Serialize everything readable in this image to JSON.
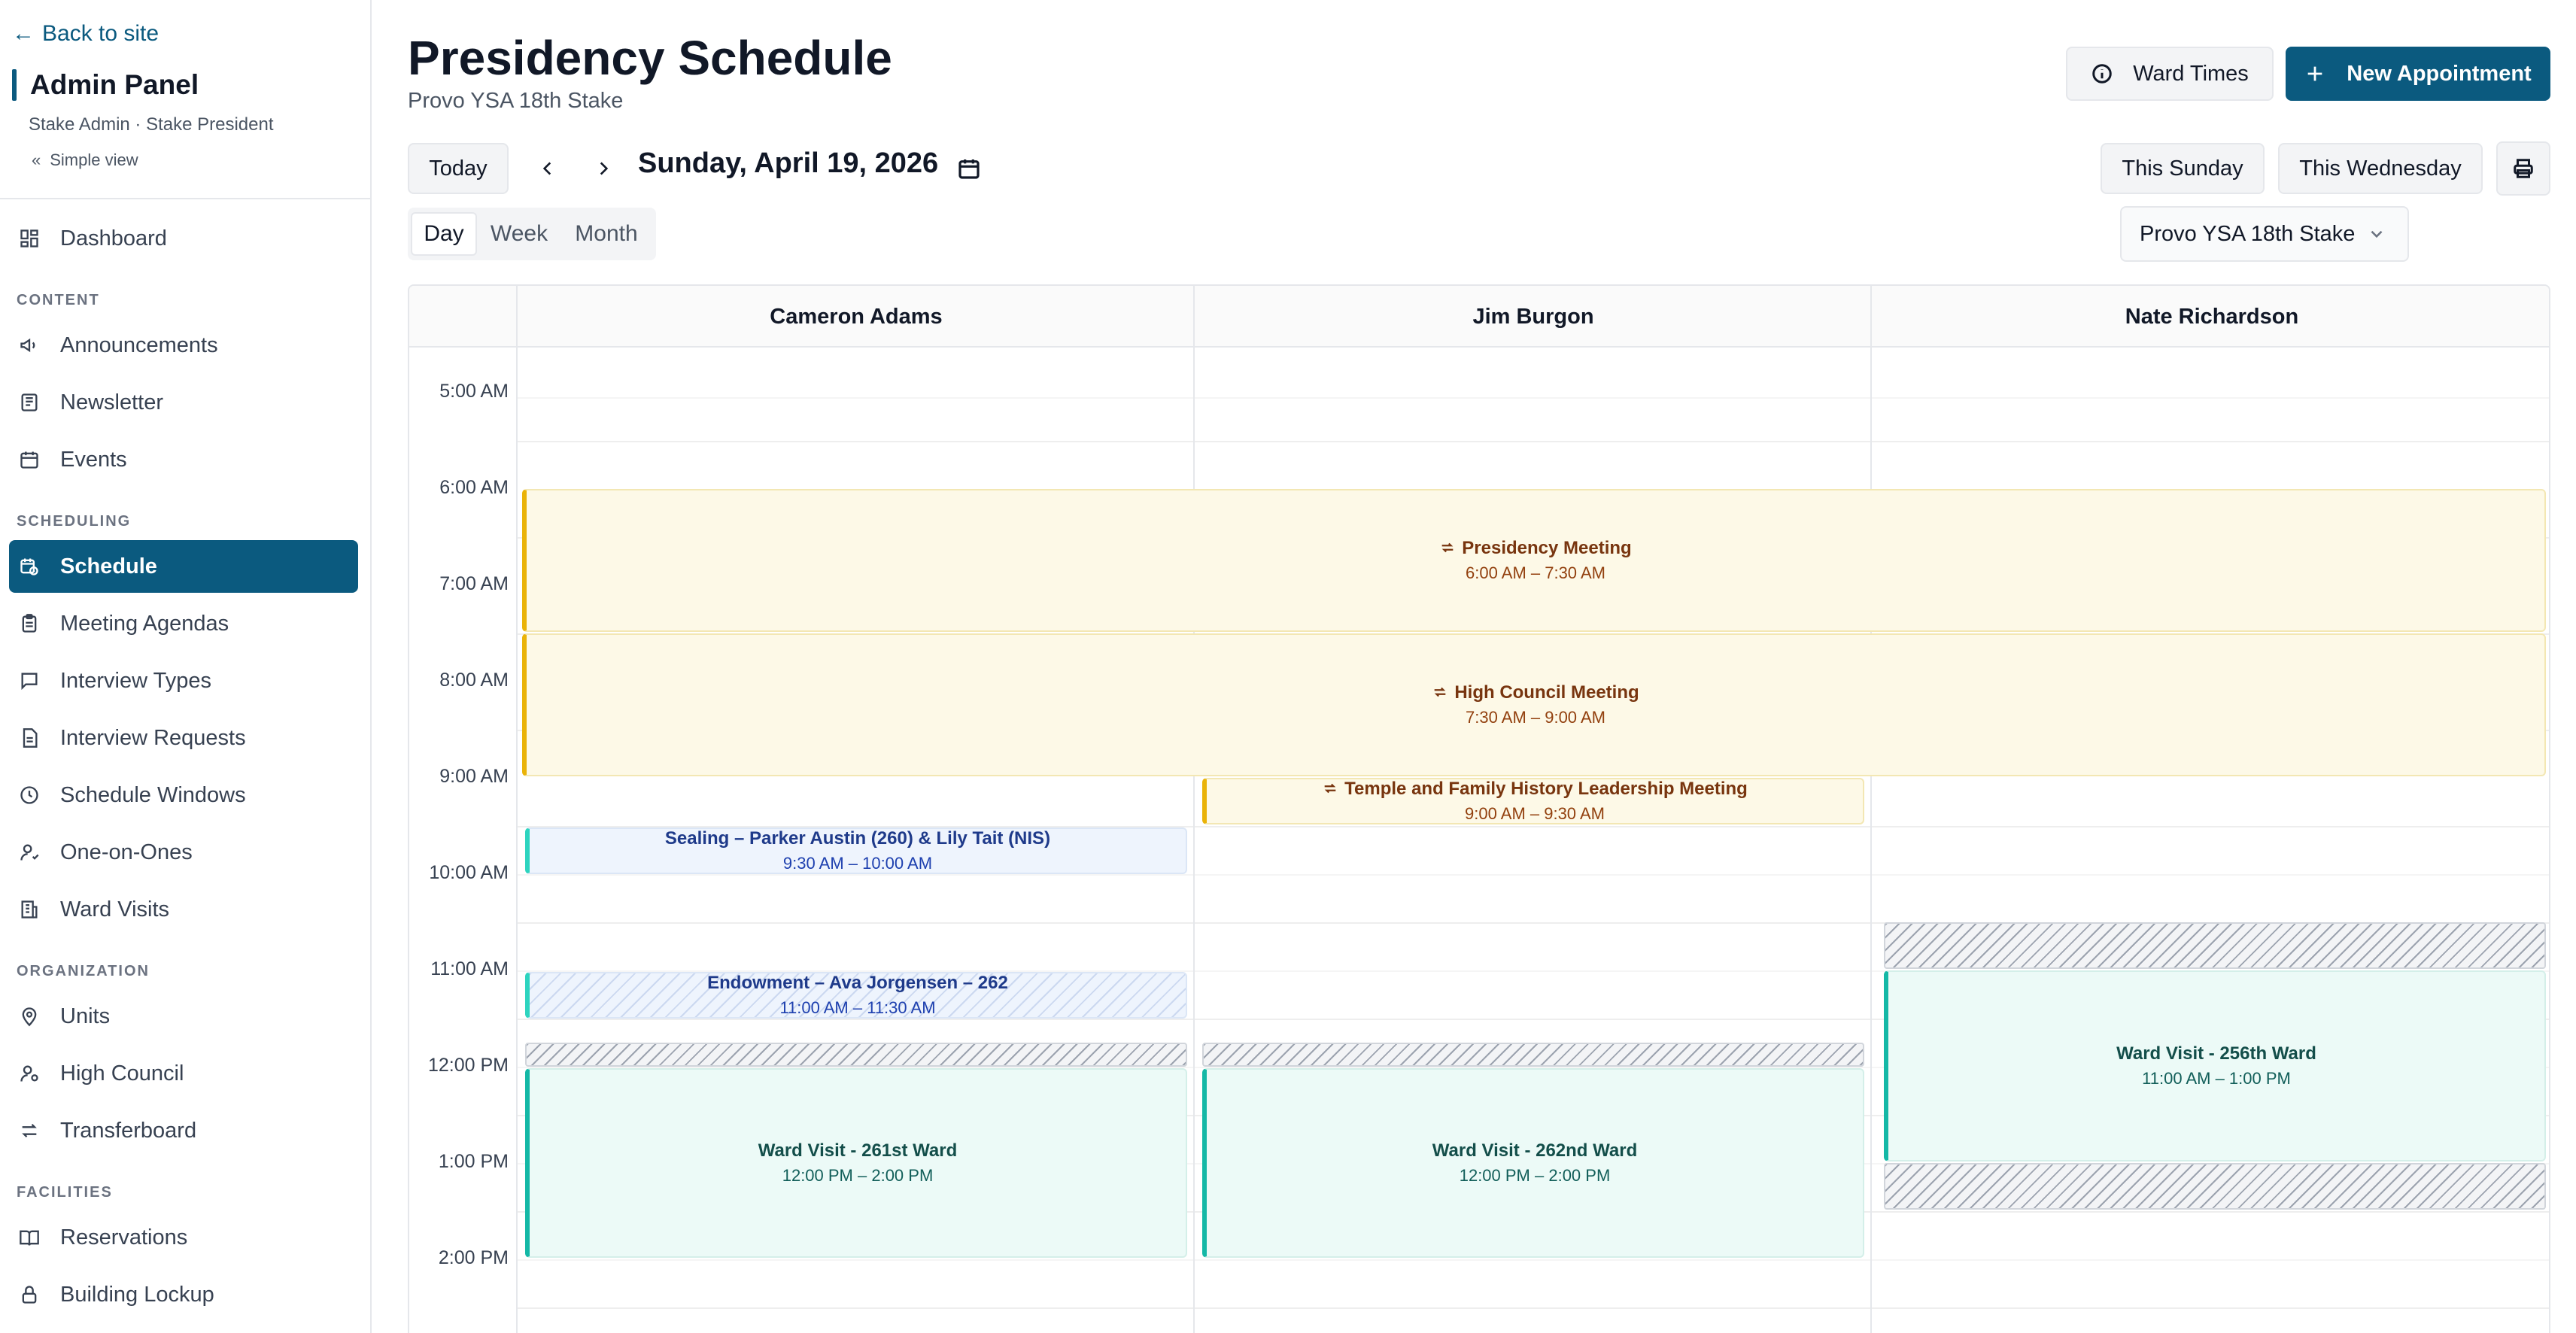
{
  "sidebar": {
    "back_label": "Back to site",
    "panel_title": "Admin Panel",
    "panel_subtitle": "Stake Admin · Stake President",
    "simple_view_label": "Simple view",
    "dashboard": "Dashboard",
    "sections": {
      "content": "CONTENT",
      "scheduling": "SCHEDULING",
      "organization": "ORGANIZATION",
      "facilities": "FACILITIES"
    },
    "items": {
      "announcements": "Announcements",
      "newsletter": "Newsletter",
      "events": "Events",
      "schedule": "Schedule",
      "meeting_agendas": "Meeting Agendas",
      "interview_types": "Interview Types",
      "interview_requests": "Interview Requests",
      "schedule_windows": "Schedule Windows",
      "one_on_ones": "One-on-Ones",
      "ward_visits": "Ward Visits",
      "units": "Units",
      "high_council": "High Council",
      "transferboard": "Transferboard",
      "reservations": "Reservations",
      "building_lockup": "Building Lockup"
    },
    "active_item": "Schedule"
  },
  "header": {
    "title": "Presidency Schedule",
    "subtitle": "Provo YSA 18th Stake",
    "ward_times_label": "Ward Times",
    "new_appointment_label": "New Appointment"
  },
  "toolbar": {
    "today_label": "Today",
    "date_label": "Sunday, April 19, 2026",
    "this_sunday_label": "This Sunday",
    "this_wednesday_label": "This Wednesday",
    "views": [
      "Day",
      "Week",
      "Month"
    ],
    "active_view": "Day",
    "stake_select_value": "Provo YSA 18th Stake"
  },
  "calendar": {
    "columns": [
      "Cameron Adams",
      "Jim Burgon",
      "Nate Richardson"
    ],
    "time_labels": [
      "5:00 AM",
      "6:00 AM",
      "7:00 AM",
      "8:00 AM",
      "9:00 AM",
      "10:00 AM",
      "11:00 AM",
      "12:00 PM",
      "1:00 PM",
      "2:00 PM"
    ],
    "events": [
      {
        "title": "Presidency Meeting",
        "time": "6:00 AM – 7:30 AM",
        "recurring": true,
        "color": "#eab308"
      },
      {
        "title": "High Council Meeting",
        "time": "7:30 AM – 9:00 AM",
        "recurring": true,
        "color": "#eab308"
      },
      {
        "title": "Temple and Family History Leadership Meeting",
        "time": "9:00 AM – 9:30 AM",
        "recurring": true,
        "color": "#eab308"
      },
      {
        "title": "Sealing – Parker Austin (260) & Lily Tait (NIS)",
        "time": "9:30 AM – 10:00 AM",
        "recurring": false,
        "color": "#2dd4bf"
      },
      {
        "title": "Endowment – Ava Jorgensen – 262",
        "time": "11:00 AM – 11:30 AM",
        "recurring": false,
        "color": "#2dd4bf"
      },
      {
        "title": "Ward Visit - 261st Ward",
        "time": "12:00 PM – 2:00 PM",
        "recurring": false,
        "color": "#14b8a6"
      },
      {
        "title": "Ward Visit - 262nd Ward",
        "time": "12:00 PM – 2:00 PM",
        "recurring": false,
        "color": "#14b8a6"
      },
      {
        "title": "Ward Visit - 256th Ward",
        "time": "11:00 AM – 1:00 PM",
        "recurring": false,
        "color": "#14b8a6"
      }
    ]
  },
  "colors": {
    "brand": "#0b5a7f",
    "meeting_accent": "#eab308",
    "visit_accent": "#14b8a6"
  }
}
